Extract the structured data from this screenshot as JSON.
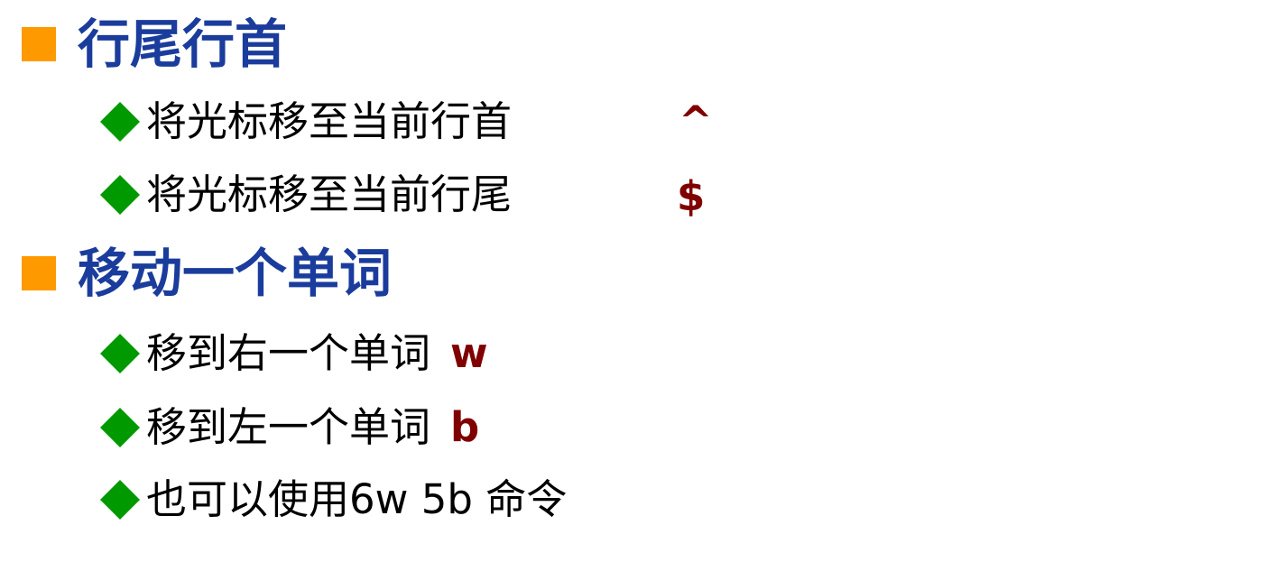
{
  "sections": [
    {
      "heading": "行尾行首",
      "items": [
        {
          "text": "将光标移至当前行首",
          "command": "^"
        },
        {
          "text": "将光标移至当前行尾",
          "command": "$"
        }
      ]
    },
    {
      "heading": "移动一个单词",
      "items": [
        {
          "text": "移到右一个单词",
          "command": "w"
        },
        {
          "text": "移到左一个单词",
          "command": "b"
        },
        {
          "text": "也可以使用6w 5b 命令",
          "command": ""
        }
      ]
    }
  ],
  "colors": {
    "heading": "#1a3c9c",
    "square_bullet": "#ff9900",
    "diamond_bullet": "#009900",
    "command": "#800000",
    "body_text": "#000000"
  },
  "icons": {
    "level1_bullet": "square-bullet-icon",
    "level2_bullet": "diamond-bullet-icon"
  }
}
